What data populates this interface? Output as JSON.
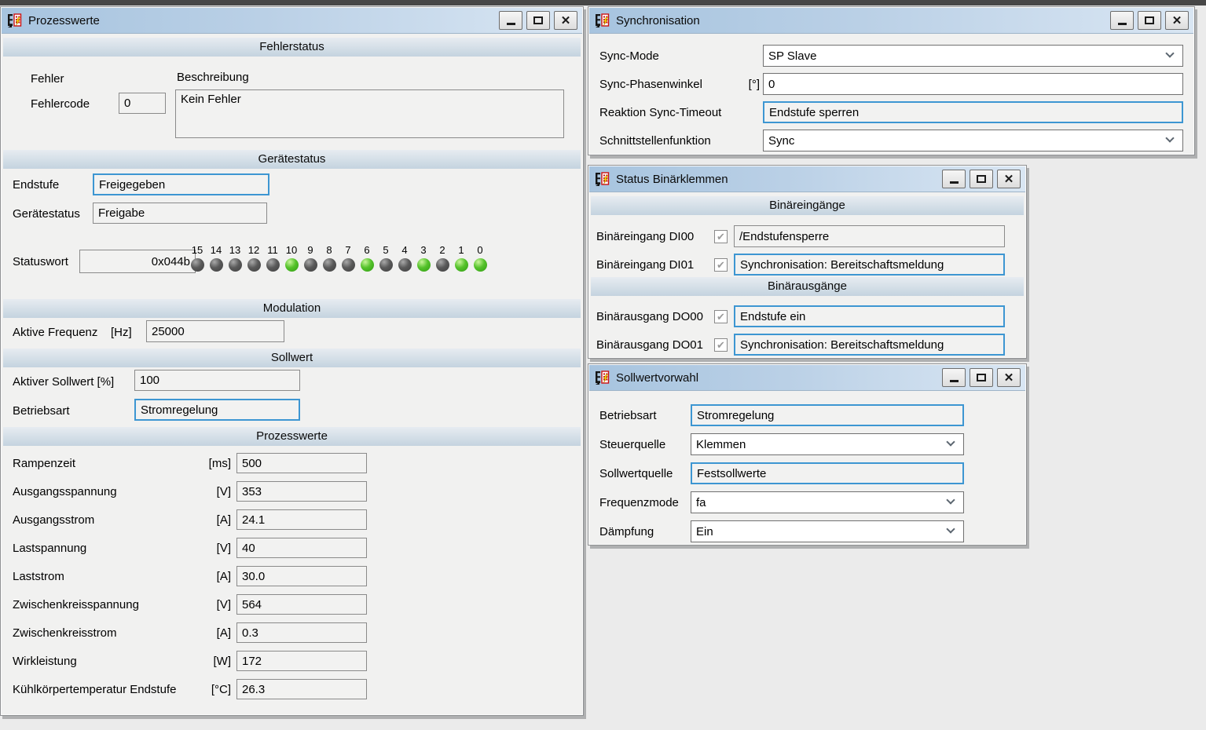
{
  "icons": {
    "minimize": "minimize-icon",
    "maximize": "maximize-icon",
    "close": "✕",
    "dropdown": "chevron-down",
    "check": "✔"
  },
  "prozesswerte": {
    "title": "Prozesswerte",
    "fehlerstatus": {
      "header": "Fehlerstatus",
      "fehler_label": "Fehler",
      "beschreibung_label": "Beschreibung",
      "fehlercode_label": "Fehlercode",
      "fehlercode_value": "0",
      "beschreibung_value": "Kein Fehler"
    },
    "geraetestatus": {
      "header": "Gerätestatus",
      "endstufe_label": "Endstufe",
      "endstufe_value": "Freigegeben",
      "geraetestatus_label": "Gerätestatus",
      "geraetestatus_value": "Freigabe",
      "statuswort_label": "Statuswort",
      "statuswort_value": "0x044b",
      "bits": [
        {
          "bit": "15",
          "state": "off"
        },
        {
          "bit": "14",
          "state": "off"
        },
        {
          "bit": "13",
          "state": "off"
        },
        {
          "bit": "12",
          "state": "off"
        },
        {
          "bit": "11",
          "state": "off"
        },
        {
          "bit": "10",
          "state": "on"
        },
        {
          "bit": "9",
          "state": "off"
        },
        {
          "bit": "8",
          "state": "off"
        },
        {
          "bit": "7",
          "state": "off"
        },
        {
          "bit": "6",
          "state": "on"
        },
        {
          "bit": "5",
          "state": "off"
        },
        {
          "bit": "4",
          "state": "off"
        },
        {
          "bit": "3",
          "state": "on"
        },
        {
          "bit": "2",
          "state": "off"
        },
        {
          "bit": "1",
          "state": "on"
        },
        {
          "bit": "0",
          "state": "on"
        }
      ]
    },
    "modulation": {
      "header": "Modulation",
      "frequenz_label": "Aktive Frequenz",
      "frequenz_unit": "[Hz]",
      "frequenz_value": "25000"
    },
    "sollwert": {
      "header": "Sollwert",
      "aktiver_sollwert_label": "Aktiver Sollwert [%]",
      "aktiver_sollwert_value": "100",
      "betriebsart_label": "Betriebsart",
      "betriebsart_value": "Stromregelung"
    },
    "prozesswerte_sektion": {
      "header": "Prozesswerte",
      "rows": [
        {
          "label": "Rampenzeit",
          "unit": "[ms]",
          "value": "500"
        },
        {
          "label": "Ausgangsspannung",
          "unit": "[V]",
          "value": "353"
        },
        {
          "label": "Ausgangsstrom",
          "unit": "[A]",
          "value": "24.1"
        },
        {
          "label": "Lastspannung",
          "unit": "[V]",
          "value": "40"
        },
        {
          "label": "Laststrom",
          "unit": "[A]",
          "value": "30.0"
        },
        {
          "label": "Zwischenkreisspannung",
          "unit": "[V]",
          "value": "564"
        },
        {
          "label": "Zwischenkreisstrom",
          "unit": "[A]",
          "value": "0.3"
        },
        {
          "label": "Wirkleistung",
          "unit": "[W]",
          "value": "172"
        },
        {
          "label": "Kühlkörpertemperatur Endstufe",
          "unit": "[°C]",
          "value": "26.3"
        }
      ]
    }
  },
  "synchronisation": {
    "title": "Synchronisation",
    "rows": [
      {
        "label": "Sync-Mode",
        "unit": "",
        "value": "SP Slave",
        "kind": "combo"
      },
      {
        "label": "Sync-Phasenwinkel",
        "unit": "[°]",
        "value": "0",
        "kind": "edit"
      },
      {
        "label": "Reaktion Sync-Timeout",
        "unit": "",
        "value": "Endstufe sperren",
        "kind": "roblue"
      },
      {
        "label": "Schnittstellenfunktion",
        "unit": "",
        "value": "Sync",
        "kind": "combo"
      }
    ]
  },
  "binaerklemmen": {
    "title": "Status Binärklemmen",
    "eingaenge_header": "Binäreingänge",
    "eingaenge": [
      {
        "label": "Binäreingang DI00",
        "check": "✔",
        "value": "/Endstufensperre",
        "kind": "rogray"
      },
      {
        "label": "Binäreingang DI01",
        "check": "✔",
        "value": "Synchronisation: Bereitschaftsmeldung",
        "kind": "roblue"
      }
    ],
    "ausgaenge_header": "Binärausgänge",
    "ausgaenge": [
      {
        "label": "Binärausgang DO00",
        "check": "✔",
        "value": "Endstufe ein",
        "kind": "roblue"
      },
      {
        "label": "Binärausgang DO01",
        "check": "✔",
        "value": "Synchronisation: Bereitschaftsmeldung",
        "kind": "roblue"
      }
    ]
  },
  "sollwertvorwahl": {
    "title": "Sollwertvorwahl",
    "rows": [
      {
        "label": "Betriebsart",
        "value": "Stromregelung",
        "kind": "roblue"
      },
      {
        "label": "Steuerquelle",
        "value": "Klemmen",
        "kind": "combo"
      },
      {
        "label": "Sollwertquelle",
        "value": "Festsollwerte",
        "kind": "roblue"
      },
      {
        "label": "Frequenzmode",
        "value": "fa",
        "kind": "combo"
      },
      {
        "label": "Dämpfung",
        "value": "Ein",
        "kind": "combo"
      }
    ]
  }
}
